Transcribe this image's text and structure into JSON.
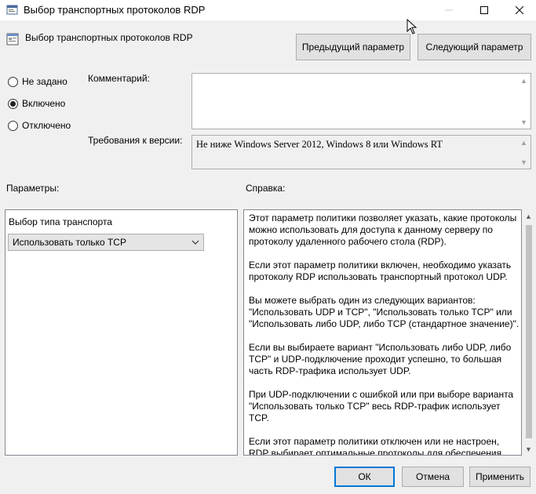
{
  "window": {
    "title": "Выбор транспортных протоколов RDP"
  },
  "header": {
    "policy_title": "Выбор транспортных протоколов RDP",
    "prev_button": "Предыдущий параметр",
    "next_button": "Следующий параметр"
  },
  "state": {
    "options": [
      {
        "label": "Не задано",
        "checked": false
      },
      {
        "label": "Включено",
        "checked": true
      },
      {
        "label": "Отключено",
        "checked": false
      }
    ]
  },
  "comment": {
    "label": "Комментарий:",
    "value": ""
  },
  "version": {
    "label": "Требования к версии:",
    "value": "Не ниже Windows Server 2012, Windows 8 или Windows RT"
  },
  "params": {
    "label": "Параметры:",
    "transport_label": "Выбор типа транспорта",
    "transport_value": "Использовать только TCP"
  },
  "help": {
    "label": "Справка:",
    "paragraphs": [
      "Этот параметр политики позволяет указать, какие протоколы можно использовать для доступа к данному серверу по протоколу удаленного рабочего стола (RDP).",
      "Если этот параметр политики включен, необходимо указать протоколу RDP использовать транспортный протокол UDP.",
      "Вы можете выбрать один из следующих вариантов: \"Использовать UDP и TCP\", \"Использовать только TCP\" или \"Использовать либо UDP, либо TCP (стандартное значение)\".",
      "Если вы выбираете вариант \"Использовать либо UDP, либо TCP\" и UDP-подключение проходит успешно, то большая часть RDP-трафика использует UDP.",
      "При UDP-подключении с ошибкой или при выборе варианта \"Использовать только TCP\" весь RDP-трафик использует TCP.",
      "Если этот параметр политики отключен или не настроен, RDP выбирает оптимальные протоколы для обеспечения наилучшего взаимодействия с пользователем."
    ]
  },
  "footer": {
    "ok": "ОК",
    "cancel": "Отмена",
    "apply": "Применить"
  },
  "colors": {
    "accent": "#0078d7",
    "window_bg": "#f0f0f0"
  }
}
